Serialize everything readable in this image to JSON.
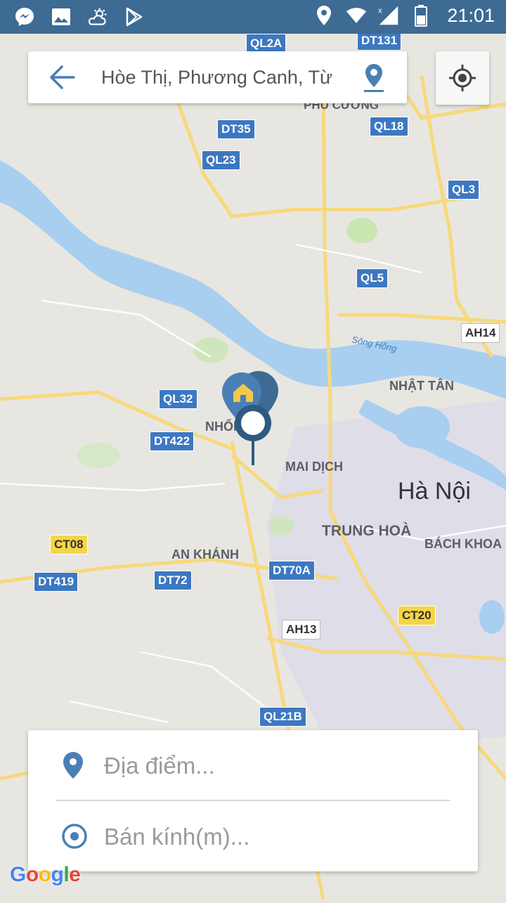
{
  "status_bar": {
    "time": "21:01",
    "left_icons": [
      "messenger-icon",
      "image-icon",
      "weather-icon",
      "play-store-icon"
    ],
    "right_icons": [
      "location-icon",
      "wifi-icon",
      "signal-icon",
      "battery-icon"
    ]
  },
  "search": {
    "value": "Hòe Thị, Phương Canh, Từ",
    "back_icon": "arrow-back-icon",
    "pin_icon": "map-pin-icon"
  },
  "my_location_icon": "my-location-icon",
  "map": {
    "city_label": "Hà Nội",
    "district_labels": [
      "PHÚ CƯỜNG",
      "NHẬT TÂN",
      "MAI DỊCH",
      "TRUNG HOÀ",
      "BÁCH KHOA",
      "AN KHÁNH",
      "NHỔN"
    ],
    "river_label": "Sông Hồng",
    "road_shields_blue": [
      "QL2A",
      "DT131",
      "DT35",
      "QL18",
      "QL23",
      "QL3",
      "QL5",
      "QL32",
      "DT422",
      "DT419",
      "DT72",
      "DT70A",
      "QL21B"
    ],
    "road_shields_yellow": [
      "CT08",
      "CT20"
    ],
    "road_shields_white": [
      "AH14",
      "AH13"
    ],
    "attribution": "Google"
  },
  "form": {
    "location_placeholder": "Địa điểm...",
    "radius_placeholder": "Bán kính(m)..."
  },
  "colors": {
    "status_bar": "#3d6b94",
    "accent": "#4a7fb5",
    "shield_blue": "#3c78c2",
    "shield_yellow": "#f5d547",
    "water": "#a8cff0",
    "road": "#f7d97a"
  }
}
